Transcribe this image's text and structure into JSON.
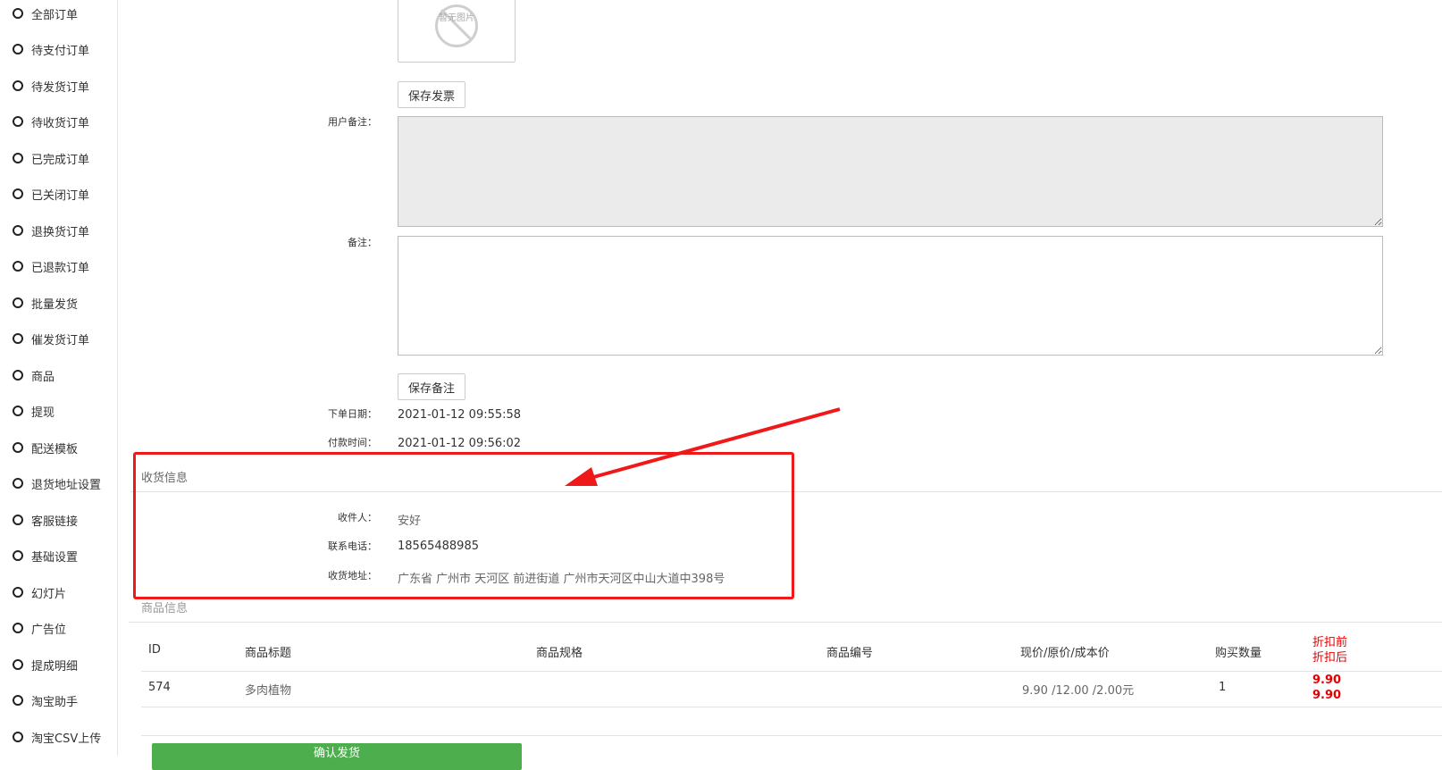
{
  "sidebar": {
    "items": [
      {
        "label": "全部订单"
      },
      {
        "label": "待支付订单"
      },
      {
        "label": "待发货订单"
      },
      {
        "label": "待收货订单"
      },
      {
        "label": "已完成订单"
      },
      {
        "label": "已关闭订单"
      },
      {
        "label": "退换货订单"
      },
      {
        "label": "已退款订单"
      },
      {
        "label": "批量发货"
      },
      {
        "label": "催发货订单"
      },
      {
        "label": "商品"
      },
      {
        "label": "提现"
      },
      {
        "label": "配送模板"
      },
      {
        "label": "退货地址设置"
      },
      {
        "label": "客服链接"
      },
      {
        "label": "基础设置"
      },
      {
        "label": "幻灯片"
      },
      {
        "label": "广告位"
      },
      {
        "label": "提成明细"
      },
      {
        "label": "淘宝助手"
      },
      {
        "label": "淘宝CSV上传"
      }
    ]
  },
  "invoice": {
    "placeholder_text": "暂无图片",
    "save_invoice_label": "保存发票"
  },
  "remarks": {
    "user_remark_label": "用户备注：",
    "remark_label": "备注：",
    "save_remark_label": "保存备注"
  },
  "order": {
    "order_date_label": "下单日期：",
    "order_date": "2021-01-12 09:55:58",
    "pay_time_label": "付款时间：",
    "pay_time": "2021-01-12 09:56:02"
  },
  "shipping": {
    "section_title": "收货信息",
    "receiver_label": "收件人：",
    "receiver": "安好",
    "phone_label": "联系电话：",
    "phone": "18565488985",
    "address_label": "收货地址：",
    "address": "广东省 广州市 天河区 前进街道 广州市天河区中山大道中398号"
  },
  "goods": {
    "section_title": "商品信息",
    "headers": {
      "id": "ID",
      "title": "商品标题",
      "spec": "商品规格",
      "code": "商品编号",
      "price": "现价/原价/成本价",
      "qty": "购买数量",
      "discount_before": "折扣前",
      "discount_after": "折扣后"
    },
    "rows": [
      {
        "id": "574",
        "title": "多肉植物",
        "spec": "",
        "code": "",
        "price": "9.90 /12.00 /2.00元",
        "qty": "1",
        "before": "9.90",
        "after": "9.90"
      }
    ]
  },
  "confirm_button_label": "确认发货",
  "colors": {
    "accent_red": "#f01919",
    "price_red": "#e40000",
    "confirm_green": "#4cae4c"
  }
}
